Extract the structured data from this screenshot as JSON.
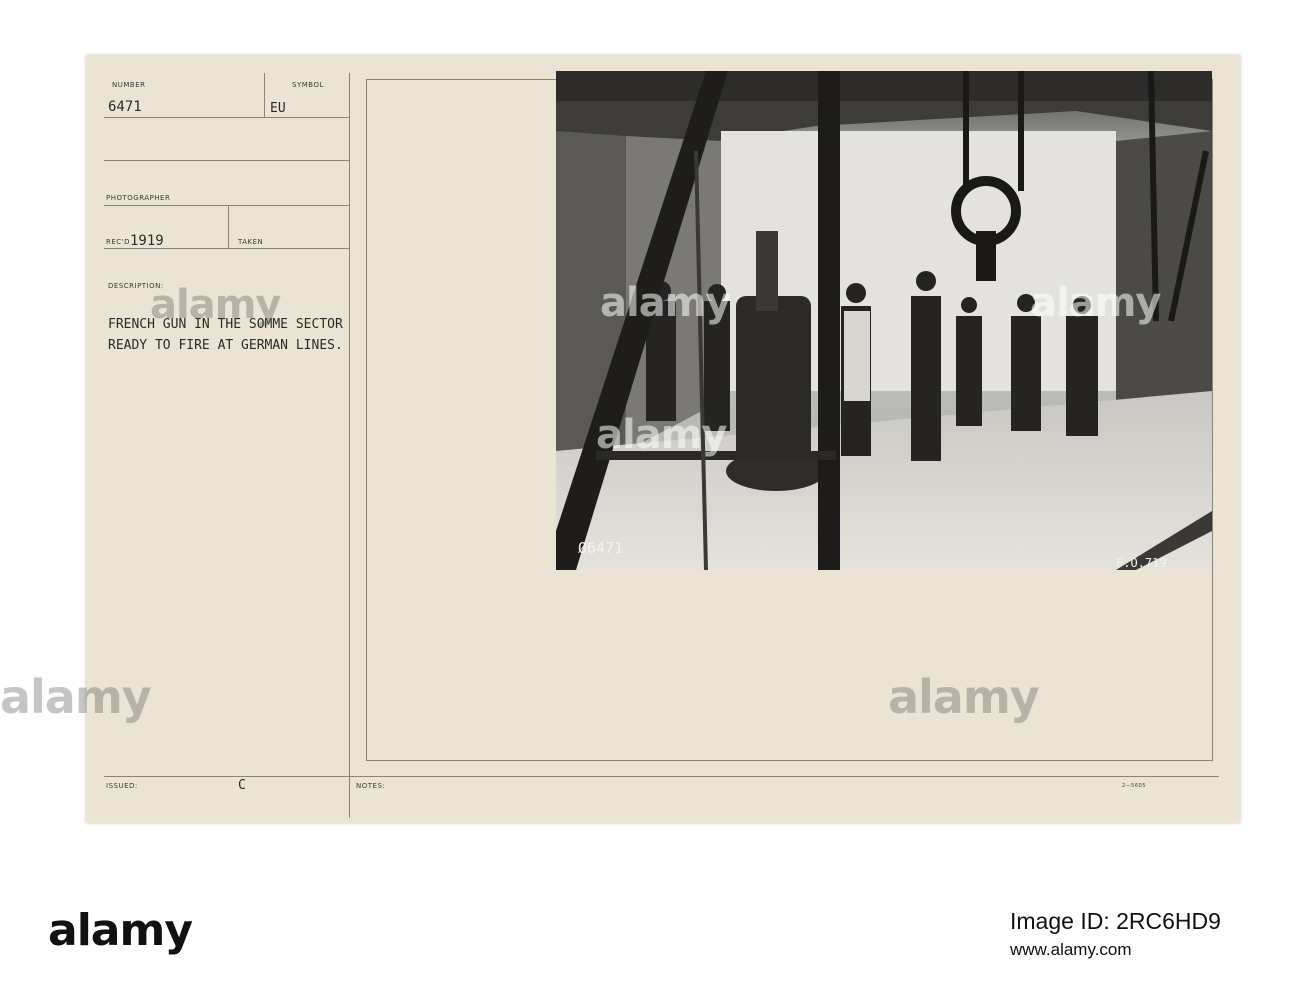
{
  "card": {
    "number_label": "NUMBER",
    "number_value": "6471",
    "symbol_label": "SYMBOL",
    "symbol_value": "EU",
    "photographer_label": "PHOTOGRAPHER",
    "recd_label": "REC'D",
    "recd_value": "1919",
    "taken_label": "TAKEN",
    "description_label": "DESCRIPTION:",
    "description_line1": "FRENCH GUN IN THE SOMME SECTOR",
    "description_line2": "READY TO FIRE AT GERMAN LINES.",
    "issued_label": "ISSUED:",
    "issued_value": "C",
    "notes_label": "NOTES:",
    "form_code": "2—5605"
  },
  "photo": {
    "negative_number": "Ø6471",
    "corner_code": "F.O.719"
  },
  "watermark": {
    "text": "alamy"
  },
  "footer": {
    "brand": "alamy",
    "image_id": "Image ID: 2RC6HD9",
    "url": "www.alamy.com"
  }
}
